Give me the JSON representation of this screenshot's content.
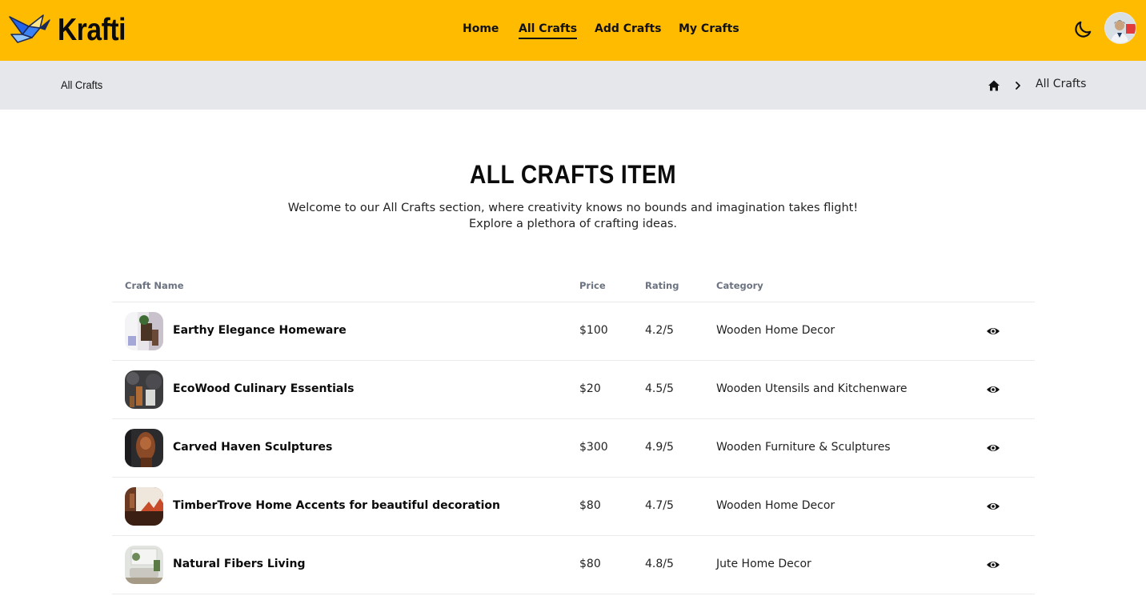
{
  "brand": {
    "name": "Krafti",
    "logo_icon": "paper-bird-logo"
  },
  "nav": {
    "links": [
      {
        "label": "Home",
        "active": false
      },
      {
        "label": "All Crafts",
        "active": true
      },
      {
        "label": "Add Crafts",
        "active": false
      },
      {
        "label": "My Crafts",
        "active": false
      }
    ],
    "theme_icon": "moon-icon",
    "avatar": "user-avatar"
  },
  "breadcrumb": {
    "title": "All Crafts",
    "home_icon": "home-icon",
    "separator_icon": "chevron-right-icon",
    "current": "All Crafts"
  },
  "page": {
    "heading": "ALL CRAFTS ITEM",
    "intro_line1": "Welcome to our All Crafts section, where creativity knows no bounds and imagination takes flight!",
    "intro_line2": "Explore a plethora of crafting ideas."
  },
  "table": {
    "headers": [
      "Craft Name",
      "Price",
      "Rating",
      "Category"
    ],
    "rows": [
      {
        "name": "Earthy Elegance Homeware",
        "price": "$100",
        "rating": "4.2/5",
        "category": "Wooden Home Decor",
        "action_icon": "eye-icon"
      },
      {
        "name": "EcoWood Culinary Essentials",
        "price": "$20",
        "rating": "4.5/5",
        "category": "Wooden Utensils and Kitchenware",
        "action_icon": "eye-icon"
      },
      {
        "name": "Carved Haven Sculptures",
        "price": "$300",
        "rating": "4.9/5",
        "category": "Wooden Furniture & Sculptures",
        "action_icon": "eye-icon"
      },
      {
        "name": "TimberTrove Home Accents for beautiful decoration",
        "price": "$80",
        "rating": "4.7/5",
        "category": "Wooden Home Decor",
        "action_icon": "eye-icon"
      },
      {
        "name": "Natural Fibers Living",
        "price": "$80",
        "rating": "4.8/5",
        "category": "Jute Home Decor",
        "action_icon": "eye-icon"
      }
    ]
  },
  "colors": {
    "navbar": "#FFBB00",
    "breadcrumb_bar": "#E5E7EB",
    "text": "#0B0B0B",
    "muted": "#6B7280"
  }
}
